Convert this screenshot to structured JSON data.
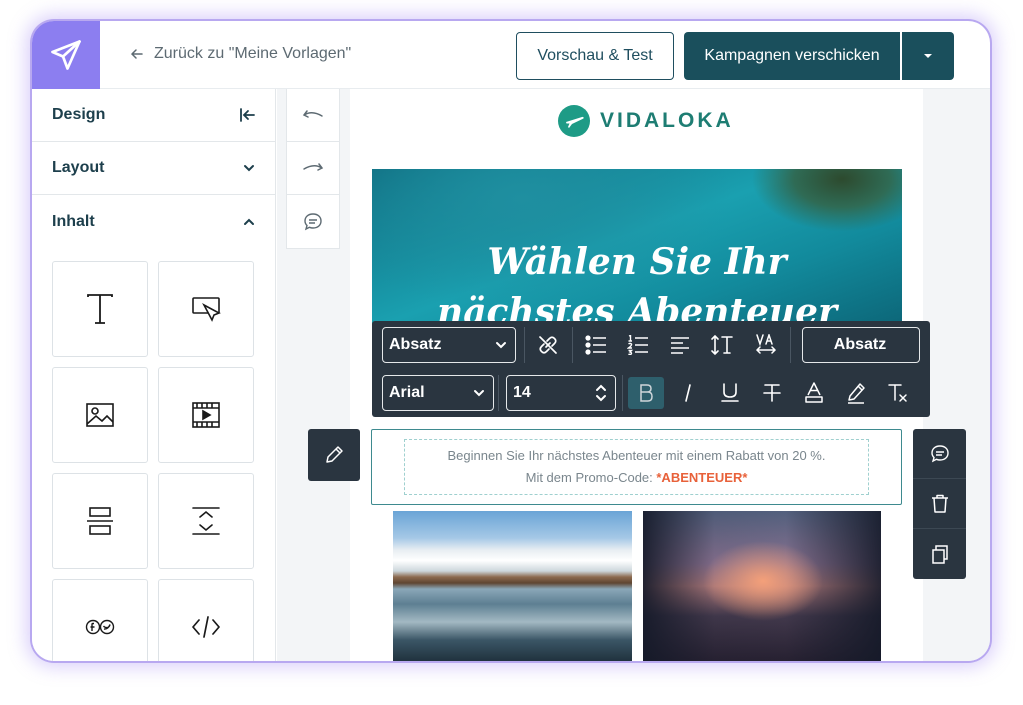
{
  "topbar": {
    "back_label": "Zurück zu \"Meine Vorlagen\"",
    "preview_label": "Vorschau & Test",
    "send_label": "Kampagnen verschicken"
  },
  "sidebar": {
    "sections": [
      {
        "label": "Design",
        "state": "collapse-panel"
      },
      {
        "label": "Layout",
        "state": "collapsed"
      },
      {
        "label": "Inhalt",
        "state": "expanded"
      }
    ],
    "tiles": [
      "text-icon",
      "button-icon",
      "image-icon",
      "video-icon",
      "divider-icon",
      "spacer-icon",
      "social-icon",
      "html-code-icon"
    ]
  },
  "email": {
    "brand_name": "VIDALOKA",
    "hero_title_line1": "Wählen Sie Ihr",
    "hero_title_line2": "nächstes Abenteuer",
    "body_line1": "Beginnen Sie Ihr nächstes Abenteuer mit einem Rabatt von 20 %.",
    "body_line2_prefix": "Mit dem Promo-Code: ",
    "promo_code": "*ABENTEUER*"
  },
  "toolbar": {
    "paragraph_select": "Absatz",
    "paragraph_button": "Absatz",
    "font_select": "Arial",
    "size_value": "14"
  },
  "colors": {
    "accent_purple": "#8c7ef0",
    "primary_teal": "#1a4f5c",
    "brand_green": "#1e7d73",
    "promo_orange": "#e8613a",
    "toolbar_dark": "#2a3540"
  }
}
